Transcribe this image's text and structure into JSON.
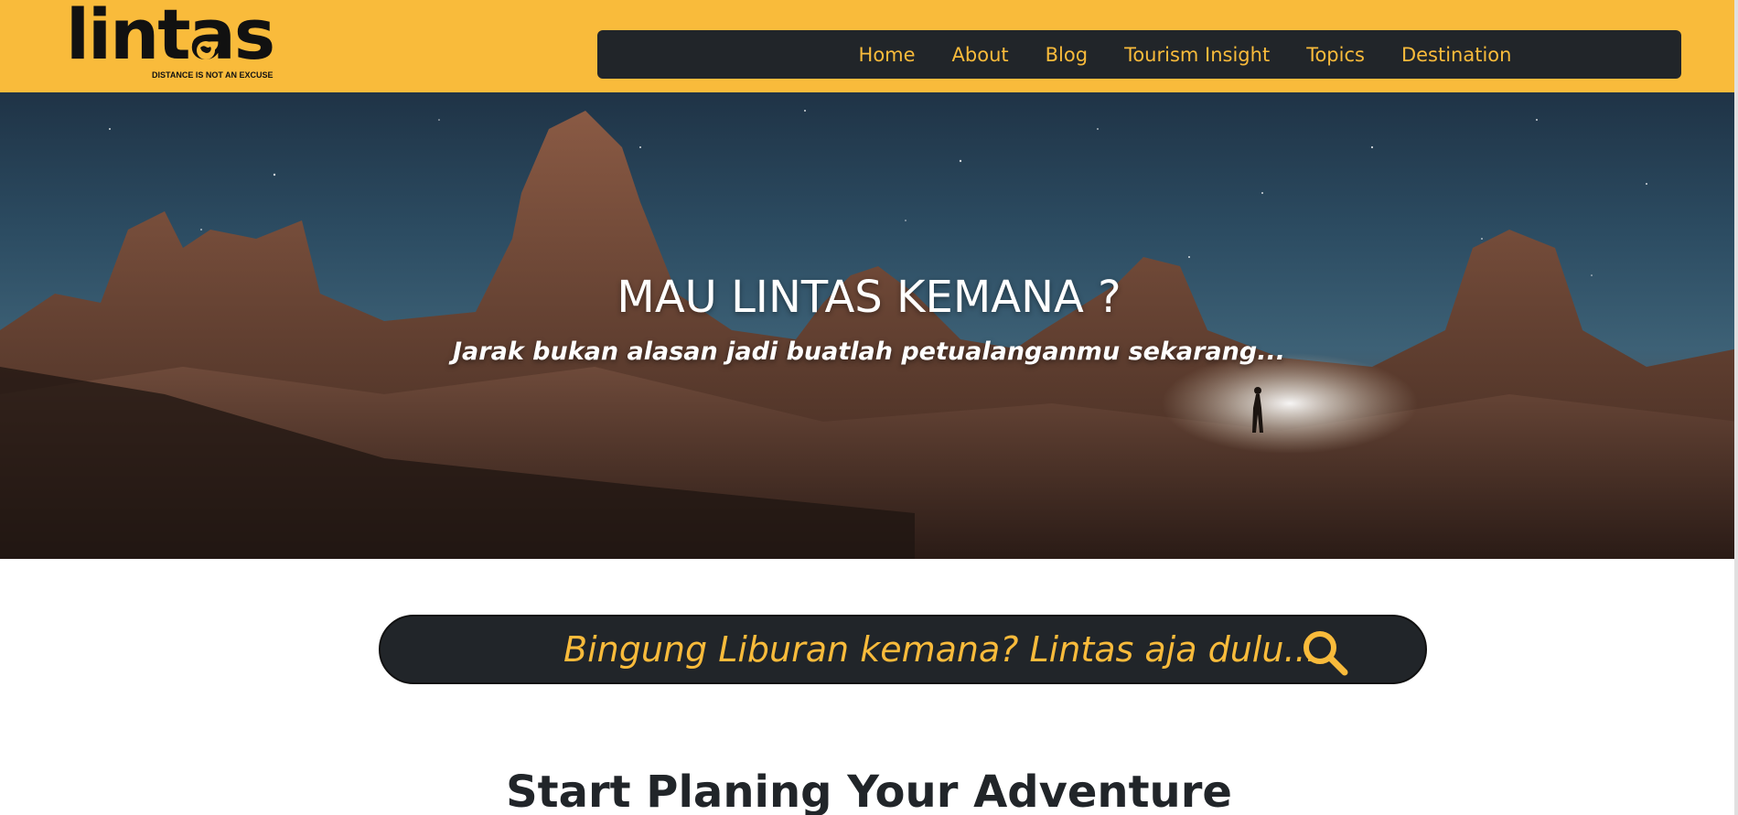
{
  "header": {
    "logo_text": "lintas",
    "logo_tagline": "DISTANCE IS NOT AN EXCUSE",
    "nav": [
      {
        "label": "Home"
      },
      {
        "label": "About"
      },
      {
        "label": "Blog"
      },
      {
        "label": "Tourism Insight"
      },
      {
        "label": "Topics"
      },
      {
        "label": "Destination"
      }
    ]
  },
  "hero": {
    "title": "MAU LINTAS KEMANA ?",
    "subtitle": "Jarak bukan alasan jadi buatlah petualanganmu sekarang..."
  },
  "search": {
    "placeholder": "Bingung Liburan kemana? Lintas aja dulu...",
    "icon": "search-icon"
  },
  "section": {
    "title": "Start Planing Your Adventure"
  },
  "colors": {
    "brand_yellow": "#f9bb3b",
    "dark": "#212529",
    "white": "#ffffff"
  }
}
